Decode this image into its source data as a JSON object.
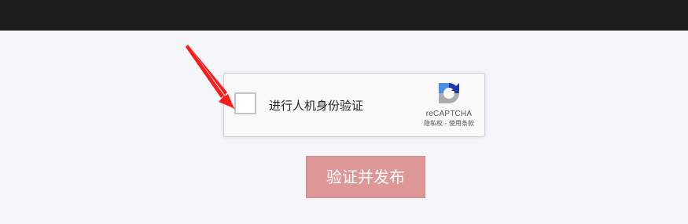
{
  "recaptcha": {
    "checkbox_label": "进行人机身份验证",
    "checked": false,
    "brand": "reCAPTCHA",
    "privacy_link": "隐私权",
    "separator": " - ",
    "terms_link": "使用条款"
  },
  "submit_button": {
    "label": "验证并发布"
  },
  "colors": {
    "topbar": "#1d1d1d",
    "page_background": "#f5f6fa",
    "button_background": "#dd9797",
    "annotation_arrow": "#ff1a1a"
  },
  "icons": {
    "recaptcha_logo": "recaptcha-logo-icon",
    "annotation": "red-arrow-icon"
  }
}
